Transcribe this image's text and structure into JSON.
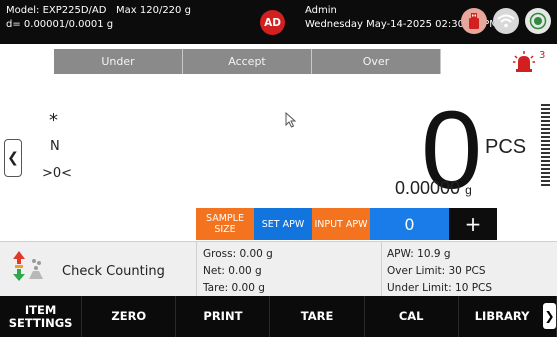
{
  "header": {
    "model": "Model: EXP225D/AD",
    "max": "Max 120/220 g",
    "division": "d= 0.00001/0.0001 g",
    "avatar_initials": "AD",
    "user": "Admin",
    "datetime": "Wednesday May-14-2025 02:30:03 PM",
    "icons": [
      "usb-icon",
      "wifi-icon",
      "record-icon"
    ]
  },
  "tolerance": {
    "under": "Under",
    "accept": "Accept",
    "over": "Over",
    "alarm_count": "3"
  },
  "display": {
    "indicators": [
      "*",
      "N",
      ">0<"
    ],
    "value": "0",
    "unit": "PCS",
    "apw_value": "0.00000",
    "apw_unit": "g"
  },
  "actions": {
    "sample_size": "SAMPLE SIZE",
    "set_apw": "SET APW",
    "input_apw": "INPUT APW",
    "count": "0",
    "plus": "+"
  },
  "info": {
    "mode": "Check Counting",
    "gross": "Gross: 0.00 g",
    "net": "Net: 0.00 g",
    "tare": "Tare: 0.00 g",
    "apw": "APW: 10.9 g",
    "over_limit": "Over Limit: 30 PCS",
    "under_limit": "Under Limit: 10 PCS"
  },
  "bottom": {
    "item_settings": "ITEM SETTINGS",
    "zero": "ZERO",
    "print": "PRINT",
    "tare": "TARE",
    "cal": "CAL",
    "library": "LIBRARY"
  },
  "colors": {
    "orange": "#f4731f",
    "blue": "#1275dd",
    "red": "#d21f1f"
  }
}
